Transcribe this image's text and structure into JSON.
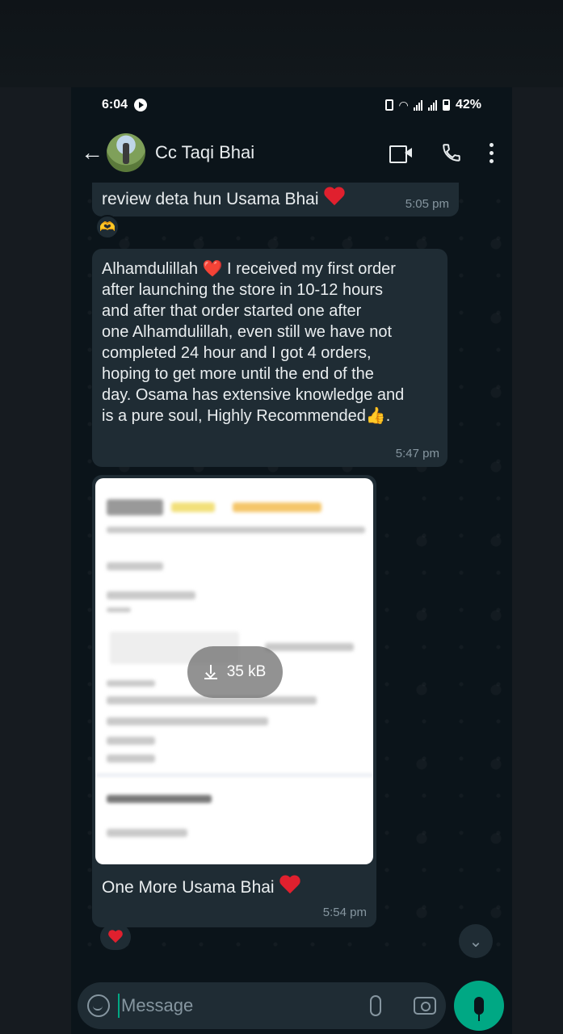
{
  "status_bar": {
    "time": "6:04",
    "battery": "42%"
  },
  "header": {
    "contact_name": "Cc Taqi Bhai"
  },
  "messages": [
    {
      "text": "review deta hun Usama Bhai",
      "time": "5:05 pm",
      "reaction": "heart-hands"
    },
    {
      "text": "Alhamdulillah ❤️ I received my first order\nafter launching the store in 10-12 hours\nand after that order started one after\none Alhamdulillah, even still we have not\ncompleted 24 hour and I got 4 orders,\nhoping to get more until the end of the\nday. Osama has extensive knowledge and\nis a pure soul, Highly Recommended👍.",
      "time": "5:47 pm"
    },
    {
      "attachment_size": "35 kB",
      "caption": "One More Usama Bhai",
      "time": "5:54 pm",
      "reaction": "heart"
    }
  ],
  "composer": {
    "placeholder": "Message"
  },
  "colors": {
    "accent": "#00a884",
    "bubble": "#1f2c34",
    "background": "#0b141a"
  }
}
